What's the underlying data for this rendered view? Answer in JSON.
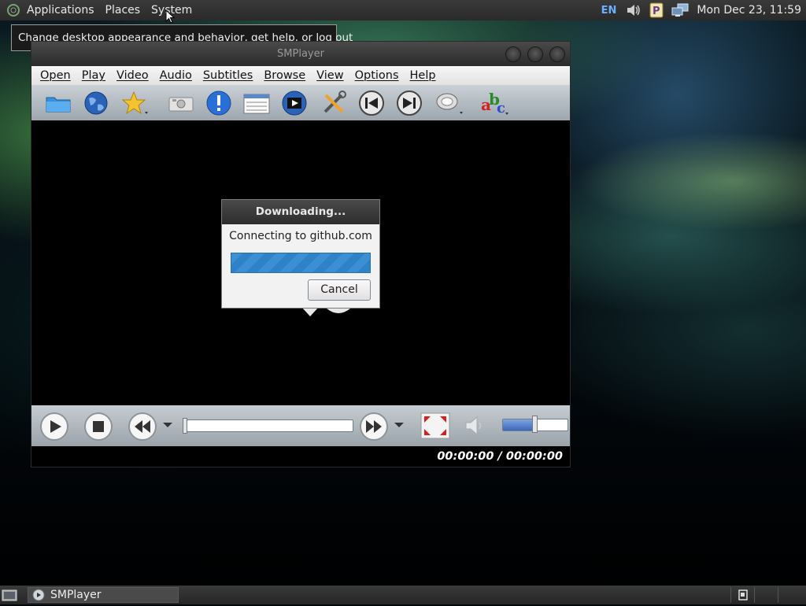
{
  "top_panel": {
    "menus": [
      "Applications",
      "Places",
      "System"
    ],
    "language": "EN",
    "clock": "Mon Dec 23, 11:59",
    "tray_icons": [
      "volume-icon",
      "pidgin-icon",
      "network-icon"
    ]
  },
  "tooltip": {
    "text": "Change desktop appearance and behavior, get help, or log out"
  },
  "window": {
    "title": "SMPlayer",
    "menu": [
      "Open",
      "Play",
      "Video",
      "Audio",
      "Subtitles",
      "Browse",
      "View",
      "Options",
      "Help"
    ],
    "toolbar_icons": [
      "folder-icon",
      "globe-icon",
      "star-favorites-icon",
      "screenshot-icon",
      "info-icon",
      "playlist-icon",
      "video-equalizer-icon",
      "preferences-tools-icon",
      "previous-icon",
      "next-icon",
      "audio-track-icon",
      "subtitles-abc-icon"
    ],
    "time_display": "00:00:00 / 00:00:00",
    "volume_level": 0.5
  },
  "dialog": {
    "title": "Downloading...",
    "message": "Connecting to github.com",
    "progress": 1.0,
    "cancel_label": "Cancel"
  },
  "taskbar": {
    "task_label": "SMPlayer"
  }
}
